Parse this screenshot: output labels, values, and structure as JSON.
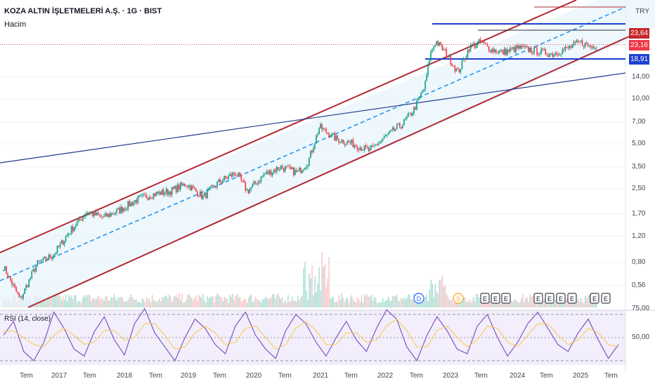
{
  "header": {
    "title": "KOZA ALTIN İŞLETMELERİ A.Ş. · 1G · BIST",
    "volume_label": "Hacim",
    "currency": "TRY"
  },
  "colors": {
    "channel": "#b22833",
    "midline": "#2196f3",
    "hline": "#1e3fd1",
    "trendline": "#1f3a8f",
    "up": "#089981",
    "down": "#f23645",
    "rsi": "#7e57c2",
    "rsi_ma": "#f7c948",
    "tag_high": "#c62828",
    "tag_last": "#f23645",
    "tag_support": "#1e3fd1"
  },
  "events": {
    "markers": [
      "D",
      "S",
      "E",
      "E",
      "E",
      "E",
      "E",
      "E",
      "E",
      "E",
      "E"
    ],
    "icons": [
      "dividend-icon",
      "split-icon",
      "earnings-icon"
    ]
  },
  "chart_data": [
    {
      "type": "line",
      "title": "KOZA ALTIN İŞLETMELERİ A.Ş. · 1G · BIST",
      "scale": "log",
      "x_ticks": [
        "Tem",
        "2017",
        "Tem",
        "2018",
        "Tem",
        "2019",
        "Tem",
        "2020",
        "Tem",
        "2021",
        "Tem",
        "2022",
        "Tem",
        "2023",
        "Tem",
        "2024",
        "Tem",
        "2025",
        "Tem"
      ],
      "y_ticks": [
        "0,56",
        "0,80",
        "1,20",
        "1,70",
        "2,50",
        "3,50",
        "5,00",
        "7,00",
        "10,00",
        "14,00"
      ],
      "price_tags": [
        {
          "label": "23,64",
          "value": 23.64,
          "kind": "high"
        },
        {
          "label": "23,16",
          "value": 23.16,
          "kind": "last"
        },
        {
          "label": "18,91",
          "value": 18.91,
          "kind": "support"
        }
      ],
      "series": [
        {
          "name": "",
          "x": [
            "2016-07",
            "2016-10",
            "2017-01",
            "2017-04",
            "2017-07",
            "2017-10",
            "2018-01",
            "2018-04",
            "2018-07",
            "2018-10",
            "2019-01",
            "2019-04",
            "2019-07",
            "2019-10",
            "2020-01",
            "2020-03",
            "2020-06",
            "2020-09",
            "2020-12",
            "2021-02",
            "2021-04",
            "2021-07",
            "2021-10",
            "2022-01",
            "2022-04",
            "2022-07",
            "2022-09",
            "2022-11",
            "2022-12",
            "2023-01",
            "2023-03",
            "2023-05",
            "2023-07",
            "2023-09",
            "2023-11",
            "2024-01",
            "2024-04",
            "2024-07",
            "2024-10",
            "2025-01",
            "2025-03",
            "2025-05",
            "2025-06"
          ],
          "values": [
            0.75,
            0.45,
            0.78,
            0.9,
            1.3,
            1.75,
            1.6,
            1.8,
            2.1,
            2.3,
            2.4,
            2.7,
            2.2,
            2.8,
            3.2,
            2.4,
            3.1,
            3.5,
            3.2,
            3.8,
            6.5,
            5.4,
            5.0,
            4.5,
            5.6,
            6.8,
            8.4,
            12.0,
            20.0,
            24.5,
            20.0,
            15.0,
            22.0,
            24.0,
            21.5,
            20.5,
            22.0,
            21.0,
            20.0,
            22.0,
            24.0,
            22.5,
            23.16
          ]
        }
      ]
    },
    {
      "type": "line",
      "title": "RSI (14, close)",
      "ylim": [
        0,
        100
      ],
      "y_ticks": [
        "75,00",
        "50,00"
      ],
      "levels": [
        70,
        50,
        30
      ],
      "series": [
        {
          "name": "",
          "values": [
            52,
            64,
            38,
            30,
            46,
            72,
            58,
            40,
            34,
            55,
            68,
            48,
            35,
            62,
            75,
            54,
            42,
            30,
            50,
            66,
            58,
            44,
            36,
            60,
            72,
            52,
            40,
            32,
            56,
            70,
            62,
            46,
            34,
            50,
            64,
            48,
            38,
            58,
            74,
            66,
            42,
            30,
            52,
            68,
            56,
            40,
            36,
            60,
            70,
            50,
            34,
            46,
            62,
            72,
            58,
            44,
            38,
            54,
            66,
            48,
            32,
            44
          ]
        },
        {
          "name": "",
          "values": [
            55,
            56,
            50,
            44,
            42,
            52,
            58,
            52,
            44,
            46,
            56,
            56,
            48,
            50,
            62,
            62,
            52,
            40,
            42,
            54,
            60,
            54,
            44,
            46,
            58,
            60,
            50,
            40,
            44,
            58,
            64,
            56,
            44,
            44,
            54,
            54,
            46,
            48,
            60,
            66,
            56,
            42,
            42,
            56,
            60,
            50,
            42,
            48,
            60,
            58,
            46,
            42,
            52,
            62,
            62,
            52,
            44,
            48,
            58,
            54,
            44,
            42
          ]
        }
      ]
    }
  ]
}
